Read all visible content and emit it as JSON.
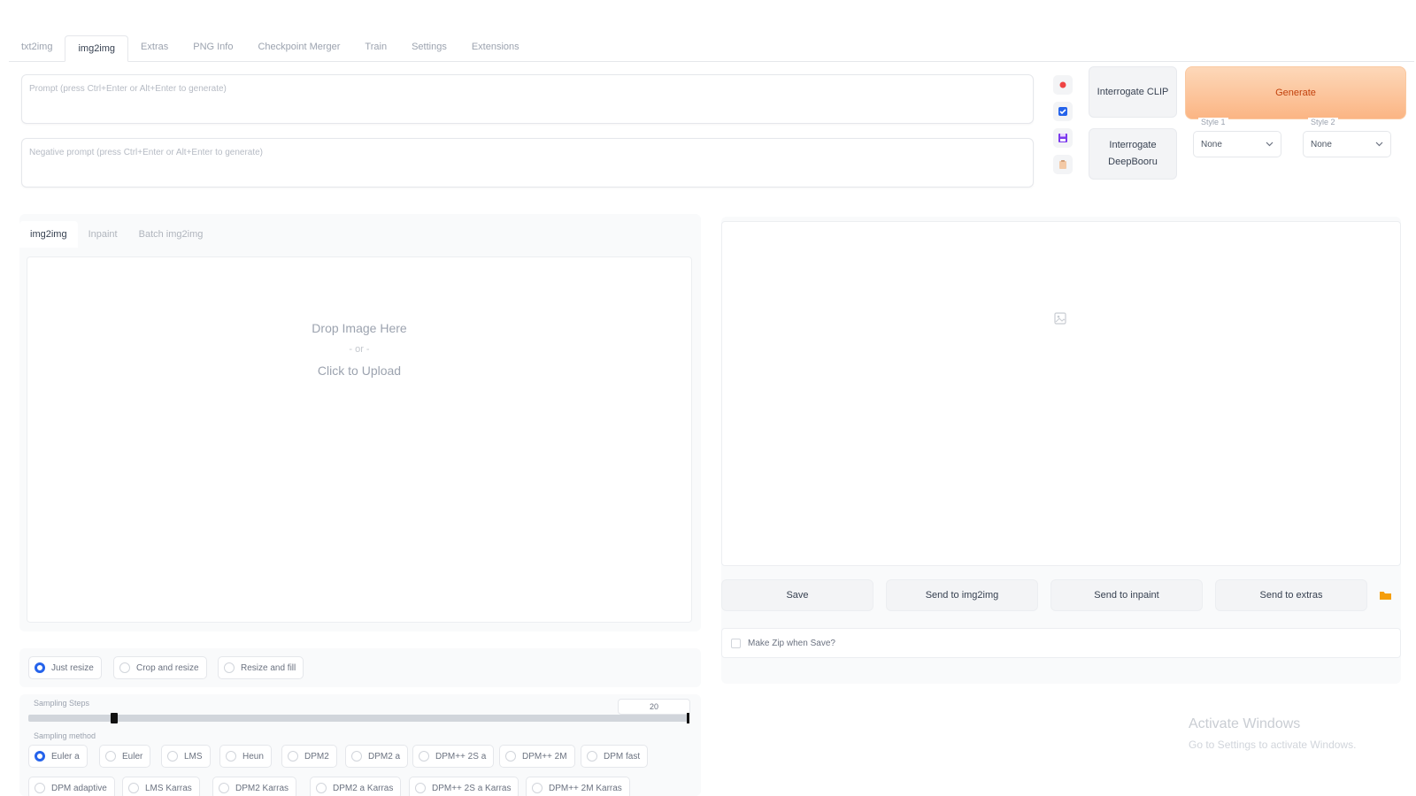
{
  "top_tabs": [
    "txt2img",
    "img2img",
    "Extras",
    "PNG Info",
    "Checkpoint Merger",
    "Train",
    "Settings",
    "Extensions"
  ],
  "prompt": {
    "placeholder": "Prompt (press Ctrl+Enter or Alt+Enter to generate)",
    "value": ""
  },
  "negative_prompt": {
    "placeholder": "Negative prompt (press Ctrl+Enter or Alt+Enter to generate)",
    "value": ""
  },
  "tool_icons": [
    "paste-icon",
    "checkbox-icon",
    "save-style-icon",
    "clipboard-icon"
  ],
  "interrogate": {
    "clip": "Interrogate CLIP",
    "deepbooru": "Interrogate DeepBooru"
  },
  "generate_label": "Generate",
  "styles": [
    {
      "label": "Style 1",
      "value": "None"
    },
    {
      "label": "Style 2",
      "value": "None"
    }
  ],
  "sub_tabs": [
    "img2img",
    "Inpaint",
    "Batch img2img"
  ],
  "drop": {
    "line1": "Drop Image Here",
    "or": "- or -",
    "line2": "Click to Upload"
  },
  "actions": [
    "Save",
    "Send to img2img",
    "Send to inpaint",
    "Send to extras"
  ],
  "zip_label": "Make Zip when Save?",
  "resize_modes": [
    "Just resize",
    "Crop and resize",
    "Resize and fill"
  ],
  "resize_selected": "Just resize",
  "sampling_steps": {
    "label": "Sampling Steps",
    "value": "20",
    "fraction": 0.13
  },
  "sampling_method": {
    "label": "Sampling method",
    "row1": [
      "Euler a",
      "Euler",
      "LMS",
      "Heun",
      "DPM2",
      "DPM2 a",
      "DPM++ 2S a",
      "DPM++ 2M",
      "DPM fast"
    ],
    "row2": [
      "DPM adaptive",
      "LMS Karras",
      "DPM2 Karras",
      "DPM2 a Karras",
      "DPM++ 2S a Karras",
      "DPM++ 2M Karras"
    ],
    "selected": "Euler a"
  },
  "watermark": {
    "title": "Activate Windows",
    "subtitle": "Go to Settings to activate Windows."
  },
  "colors": {
    "accent": "#2563eb",
    "generate_bg": "#fbb584",
    "generate_text": "#c2410c"
  }
}
